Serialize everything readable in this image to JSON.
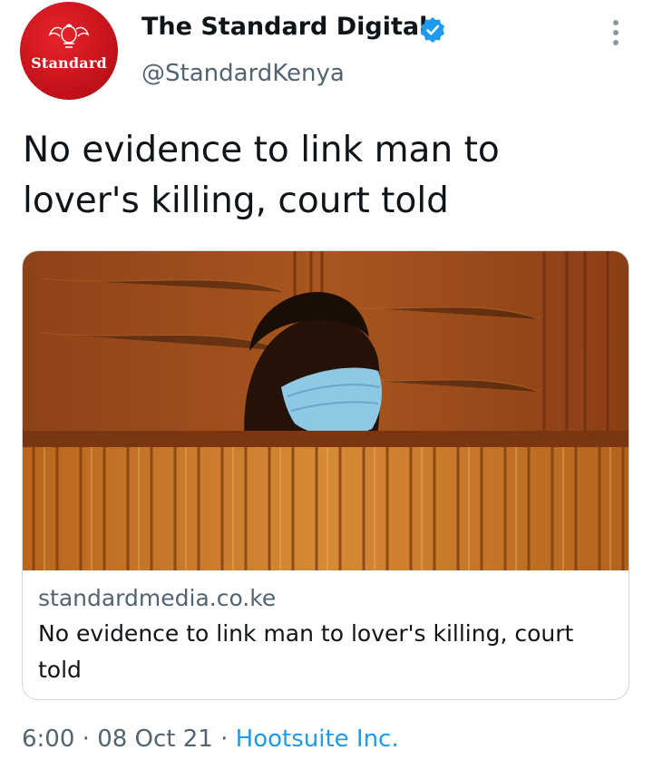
{
  "account": {
    "display_name": "The Standard Digital",
    "handle": "@StandardKenya",
    "avatar_text": "Standard",
    "verified": true
  },
  "tweet": {
    "text": "No evidence to link man to lover's killing, court told"
  },
  "card": {
    "domain": "standardmedia.co.ke",
    "title": "No evidence to link man to lover's killing, court told",
    "image_icon": "photo-man-in-court-dock"
  },
  "footer": {
    "time": "6:00",
    "separator": "·",
    "date": "08 Oct 21",
    "source": "Hootsuite Inc."
  },
  "colors": {
    "brand_red": "#d0151d",
    "verified_blue": "#1d9bf0",
    "secondary_text": "#536471",
    "link": "#1d9bf0"
  },
  "icons": {
    "menu": "more-vertical-icon",
    "badge": "verified-badge-icon"
  }
}
